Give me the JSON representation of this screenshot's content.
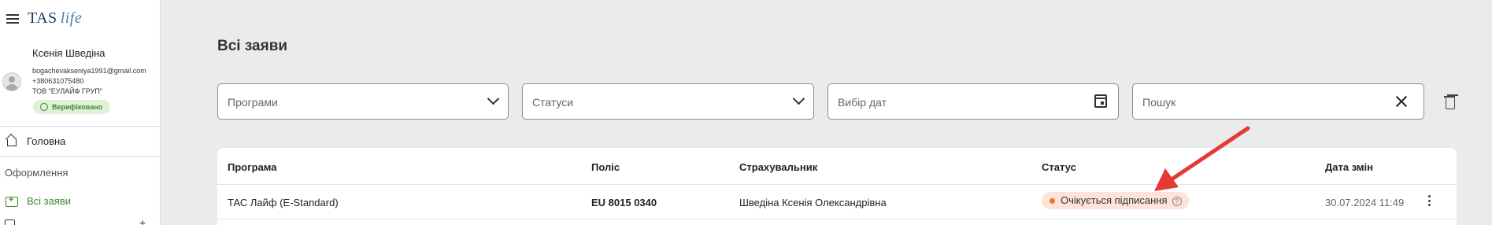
{
  "app": {
    "brand_main": "TAS",
    "brand_sub": "life"
  },
  "user": {
    "name": "Ксенія Шведіна",
    "email": "bogachevakseniya1991@gmail.com",
    "phone": "+380631075480",
    "company": "ТОВ \"ЕУЛАЙФ ГРУП\"",
    "verified_label": "Верифіковано"
  },
  "nav": {
    "home": "Головна",
    "section": "Оформлення",
    "all_requests": "Всі заяви"
  },
  "page": {
    "title": "Всі заяви"
  },
  "filters": {
    "programs": "Програми",
    "statuses": "Статуси",
    "dates": "Вибір дат",
    "search": "Пошук"
  },
  "table": {
    "headers": [
      "Програма",
      "Поліс",
      "Страхувальник",
      "Статус",
      "Дата змін"
    ],
    "rows": [
      {
        "program": "ТАС Лайф (E-Standard)",
        "policy": "EU 8015 0340",
        "insurer": "Шведіна Ксенія Олександрівна",
        "status": "Очікується підписання",
        "changed": "30.07.2024 11:49"
      }
    ]
  },
  "colors": {
    "accent_green": "#3c8a2e",
    "status_orange": "#f0742c",
    "annotation_arrow": "#e53935"
  }
}
